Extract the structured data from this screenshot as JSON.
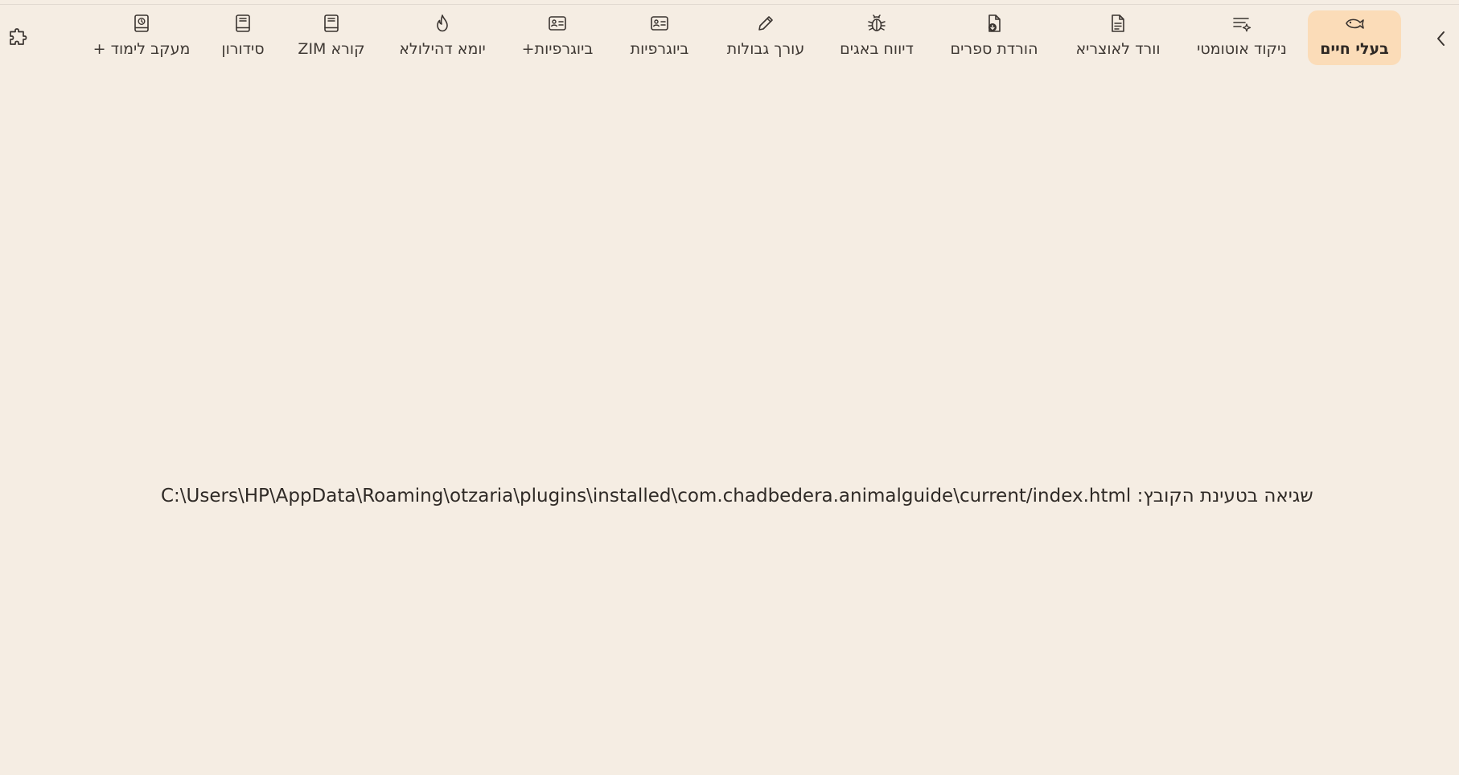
{
  "toolbar": {
    "tabs": [
      {
        "label": "בעלי חיים",
        "icon": "animal-fish-icon",
        "active": true
      },
      {
        "label": "ניקוד אוטומטי",
        "icon": "text-sparkle-icon",
        "active": false
      },
      {
        "label": "וורד לאוצריא",
        "icon": "document-icon",
        "active": false
      },
      {
        "label": "הורדת ספרים",
        "icon": "file-download-icon",
        "active": false
      },
      {
        "label": "דיווח באגים",
        "icon": "bug-icon",
        "active": false
      },
      {
        "label": "עורך גבולות",
        "icon": "pencil-icon",
        "active": false
      },
      {
        "label": "ביוגרפיות",
        "icon": "contact-card-icon",
        "active": false
      },
      {
        "label": "ביוגרפיות+",
        "icon": "contact-card-icon",
        "active": false
      },
      {
        "label": "יומא דהילולא",
        "icon": "flame-icon",
        "active": false
      },
      {
        "label": "קורא ZIM",
        "icon": "book-icon",
        "active": false
      },
      {
        "label": "סידורון",
        "icon": "book-icon",
        "active": false
      },
      {
        "label": "מעקב לימוד +",
        "icon": "book-clock-icon",
        "active": false
      }
    ],
    "chevron_icon": "chevron-left-icon",
    "plugins_icon": "puzzle-icon"
  },
  "content": {
    "error_prefix": "שגיאה בטעינת הקובץ:",
    "error_path": "C:\\Users\\HP\\AppData\\Roaming\\otzaria\\plugins\\installed\\com.chadbedera.animalguide\\current/index.html"
  },
  "colors": {
    "background": "#f5ede3",
    "active_tab": "#fbdcb8",
    "text": "#3a3430"
  }
}
